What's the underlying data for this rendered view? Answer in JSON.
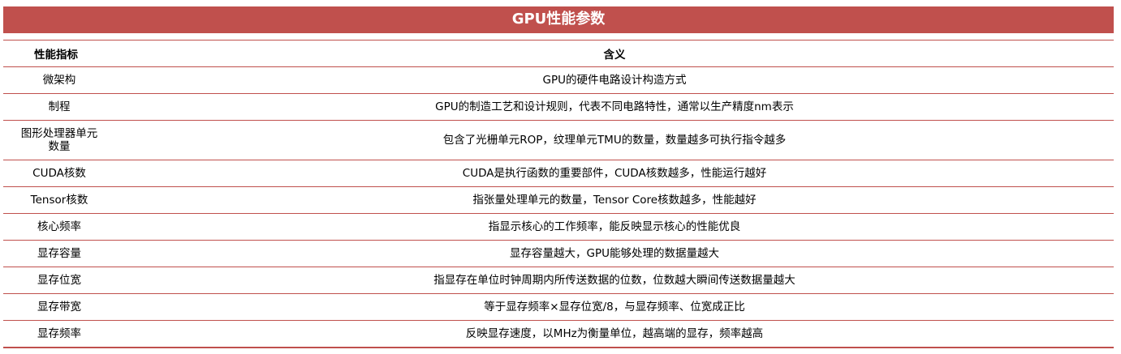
{
  "title": "GPU性能参数",
  "headers": {
    "metric": "性能指标",
    "meaning": "含义"
  },
  "rows": [
    {
      "metric": "微架构",
      "meaning": "GPU的硬件电路设计构造方式"
    },
    {
      "metric": "制程",
      "meaning": "GPU的制造工艺和设计规则，代表不同电路特性，通常以生产精度nm表示"
    },
    {
      "metric": "图形处理器单元数量",
      "metric_line1": "图形处理器单元",
      "metric_line2": "数量",
      "meaning": "包含了光栅单元ROP，纹理单元TMU的数量，数量越多可执行指令越多"
    },
    {
      "metric": "CUDA核数",
      "meaning": "CUDA是执行函数的重要部件，CUDA核数越多，性能运行越好"
    },
    {
      "metric": "Tensor核数",
      "meaning": "指张量处理单元的数量，Tensor Core核数越多，性能越好"
    },
    {
      "metric": "核心频率",
      "meaning": "指显示核心的工作频率，能反映显示核心的性能优良"
    },
    {
      "metric": "显存容量",
      "meaning": "显存容量越大，GPU能够处理的数据量越大"
    },
    {
      "metric": "显存位宽",
      "meaning": "指显存在单位时钟周期内所传送数据的位数，位数越大瞬间传送数据量越大"
    },
    {
      "metric": "显存带宽",
      "meaning": "等于显存频率×显存位宽/8，与显存频率、位宽成正比"
    },
    {
      "metric": "显存频率",
      "meaning": "反映显存速度，以MHz为衡量单位，越高端的显存，频率越高"
    }
  ],
  "colors": {
    "accent": "#c0504d"
  }
}
